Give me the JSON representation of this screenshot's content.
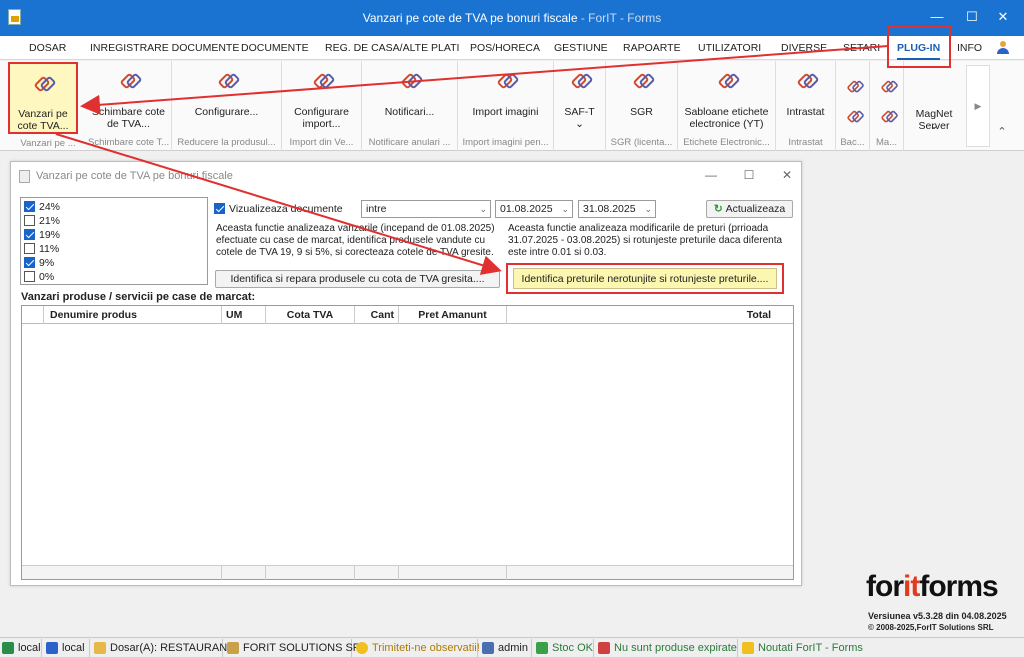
{
  "window": {
    "title": "Vanzari pe cote de TVA pe bonuri fiscale",
    "title_suffix": " - ForIT - Forms",
    "minimize": "—",
    "maximize": "☐",
    "close": "✕"
  },
  "menu": [
    "DOSAR",
    "INREGISTRARE DOCUMENTE",
    "DOCUMENTE",
    "REG. DE CASA/ALTE PLATI",
    "POS/HORECA",
    "GESTIUNE",
    "RAPOARTE",
    "UTILIZATORI",
    "DIVERSE",
    "SETARI",
    "PLUG-IN",
    "INFO"
  ],
  "ribbon": [
    {
      "label": "Vanzari pe cote TVA...",
      "group": "Vanzari pe ..."
    },
    {
      "label": "Schimbare cote de TVA...",
      "group": "Schimbare cote T..."
    },
    {
      "label": "Configurare...",
      "group": "Reducere la produsul..."
    },
    {
      "label": "Configurare import...",
      "group": "Import din Ve..."
    },
    {
      "label": "Notificari...",
      "group": "Notificare anulari ..."
    },
    {
      "label": "Import imagini",
      "group": "Import imagini pen..."
    },
    {
      "label": "SAF-T",
      "group": ""
    },
    {
      "label": "SGR",
      "group": "SGR (licenta..."
    },
    {
      "label": "Sabloane etichete electronice (YT)",
      "group": "Etichete Electronic..."
    },
    {
      "label": "Intrastat",
      "group": "Intrastat"
    },
    {
      "label": "",
      "group": "Bac..."
    },
    {
      "label": "",
      "group": "Ma..."
    },
    {
      "label": "MagNet Server",
      "group": ""
    }
  ],
  "dialog": {
    "title": "Vanzari pe cote de TVA pe bonuri fiscale",
    "vat_rates": [
      {
        "label": "24%",
        "checked": true
      },
      {
        "label": "21%",
        "checked": false
      },
      {
        "label": "19%",
        "checked": true
      },
      {
        "label": "11%",
        "checked": false
      },
      {
        "label": "9%",
        "checked": true
      },
      {
        "label": "0%",
        "checked": false
      }
    ],
    "show_docs_label": "Vizualizeaza documente",
    "period_type": "intre",
    "date_from": "01.08.2025",
    "date_to": "31.08.2025",
    "refresh_label": "Actualizeaza",
    "desc_left": "Aceasta functie analizeaza vanzarile (incepand de 01.08.2025) efectuate cu case de marcat, identifica produsele vandute cu cotele de TVA 19, 9 si 5%, si corecteaza cotele de TVA gresite.",
    "desc_right": "Aceasta functie analizeaza modificarile de preturi (prrioada 31.07.2025 - 03.08.2025) si rotunjeste preturile daca diferenta este intre 0.01 si 0.03.",
    "repair_button": "Identifica si repara produsele cu cota de TVA gresita....",
    "round_button": "Identifica preturile nerotunjite si rotunjeste preturile....",
    "section_title": "Vanzari produse / servicii pe case de marcat:",
    "columns": [
      "Denumire produs",
      "UM",
      "Cota TVA",
      "Cant",
      "Pret Amanunt",
      "Total"
    ]
  },
  "brand": {
    "pre": "for",
    "mid": "it",
    "post": "forms",
    "version": "Versiunea v5.3.28 din 04.08.2025",
    "copyright": "© 2008-2025,ForIT Solutions SRL"
  },
  "status": [
    "local",
    "local",
    "Dosar(A): RESTAURANT",
    "FORIT SOLUTIONS SRL",
    "Trimiteti-ne observatii!",
    "admin",
    "Stoc OK",
    "Nu sunt produse expirate",
    "Noutati ForIT - Forms"
  ]
}
